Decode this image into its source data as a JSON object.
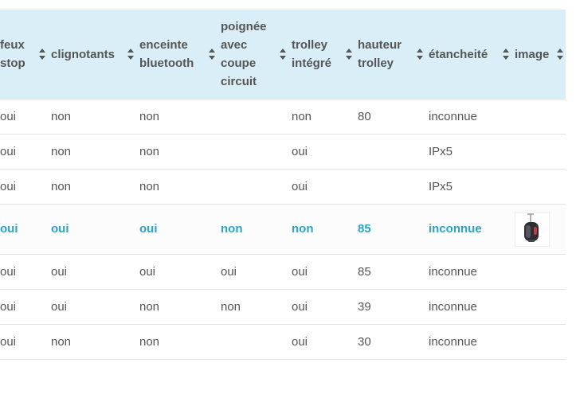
{
  "table": {
    "headers": [
      {
        "label": "feux stop",
        "lines": [
          "feux",
          "stop"
        ]
      },
      {
        "label": "clignotants",
        "lines": [
          "clignotants"
        ]
      },
      {
        "label": "enceinte bluetooth",
        "lines": [
          "enceinte",
          "bluetooth"
        ]
      },
      {
        "label": "poignée avec coupe circuit",
        "lines": [
          "poignée",
          "avec",
          "coupe",
          "circuit"
        ]
      },
      {
        "label": "trolley intégré",
        "lines": [
          "trolley",
          "intégré"
        ]
      },
      {
        "label": "hauteur trolley",
        "lines": [
          "hauteur",
          "trolley"
        ]
      },
      {
        "label": "étancheité",
        "lines": [
          "étancheité"
        ]
      },
      {
        "label": "image",
        "lines": [
          "image"
        ]
      }
    ],
    "rows": [
      [
        "oui",
        "non",
        "non",
        "",
        "non",
        "80",
        "inconnue",
        ""
      ],
      [
        "oui",
        "non",
        "non",
        "",
        "oui",
        "",
        "IPx5",
        ""
      ],
      [
        "oui",
        "non",
        "non",
        "",
        "oui",
        "",
        "IPx5",
        ""
      ],
      [
        "oui",
        "oui",
        "oui",
        "non",
        "non",
        "85",
        "inconnue",
        "thumbnail"
      ],
      [
        "oui",
        "oui",
        "oui",
        "oui",
        "oui",
        "85",
        "inconnue",
        ""
      ],
      [
        "oui",
        "oui",
        "non",
        "non",
        "oui",
        "39",
        "inconnue",
        ""
      ],
      [
        "oui",
        "non",
        "non",
        "",
        "oui",
        "30",
        "inconnue",
        ""
      ]
    ],
    "highlighted_row": 3
  },
  "colors": {
    "header_bg": "#d9eef7",
    "highlight_text": "#29a3cc",
    "text": "#555555"
  }
}
